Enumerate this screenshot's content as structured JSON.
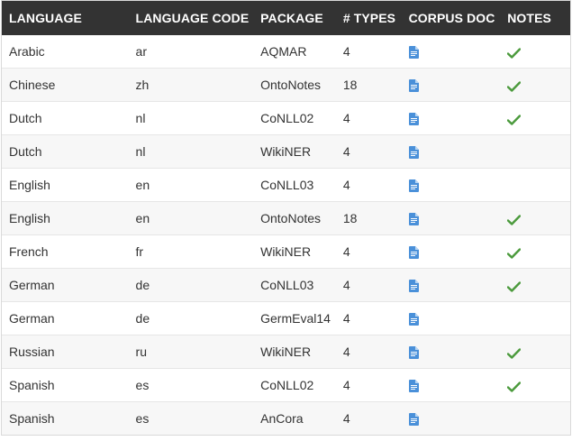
{
  "table": {
    "headers": [
      "LANGUAGE",
      "LANGUAGE CODE",
      "PACKAGE",
      "# TYPES",
      "CORPUS DOC",
      "NOTES"
    ],
    "rows": [
      {
        "language": "Arabic",
        "code": "ar",
        "package": "AQMAR",
        "types": "4",
        "doc_icon": "document-icon",
        "notes": true
      },
      {
        "language": "Chinese",
        "code": "zh",
        "package": "OntoNotes",
        "types": "18",
        "doc_icon": "document-icon",
        "notes": true
      },
      {
        "language": "Dutch",
        "code": "nl",
        "package": "CoNLL02",
        "types": "4",
        "doc_icon": "document-icon",
        "notes": true
      },
      {
        "language": "Dutch",
        "code": "nl",
        "package": "WikiNER",
        "types": "4",
        "doc_icon": "document-icon",
        "notes": false
      },
      {
        "language": "English",
        "code": "en",
        "package": "CoNLL03",
        "types": "4",
        "doc_icon": "document-icon",
        "notes": false
      },
      {
        "language": "English",
        "code": "en",
        "package": "OntoNotes",
        "types": "18",
        "doc_icon": "document-icon",
        "notes": true
      },
      {
        "language": "French",
        "code": "fr",
        "package": "WikiNER",
        "types": "4",
        "doc_icon": "document-icon",
        "notes": true
      },
      {
        "language": "German",
        "code": "de",
        "package": "CoNLL03",
        "types": "4",
        "doc_icon": "document-icon",
        "notes": true
      },
      {
        "language": "German",
        "code": "de",
        "package": "GermEval14",
        "types": "4",
        "doc_icon": "document-icon",
        "notes": false
      },
      {
        "language": "Russian",
        "code": "ru",
        "package": "WikiNER",
        "types": "4",
        "doc_icon": "document-icon",
        "notes": true
      },
      {
        "language": "Spanish",
        "code": "es",
        "package": "CoNLL02",
        "types": "4",
        "doc_icon": "document-icon",
        "notes": true
      },
      {
        "language": "Spanish",
        "code": "es",
        "package": "AnCora",
        "types": "4",
        "doc_icon": "document-icon",
        "notes": false
      }
    ]
  },
  "colors": {
    "header_bg": "#333333",
    "header_text": "#ffffff",
    "doc_icon": "#4a90d9",
    "check": "#4b9a3c",
    "alt_row": "#f7f7f7"
  }
}
